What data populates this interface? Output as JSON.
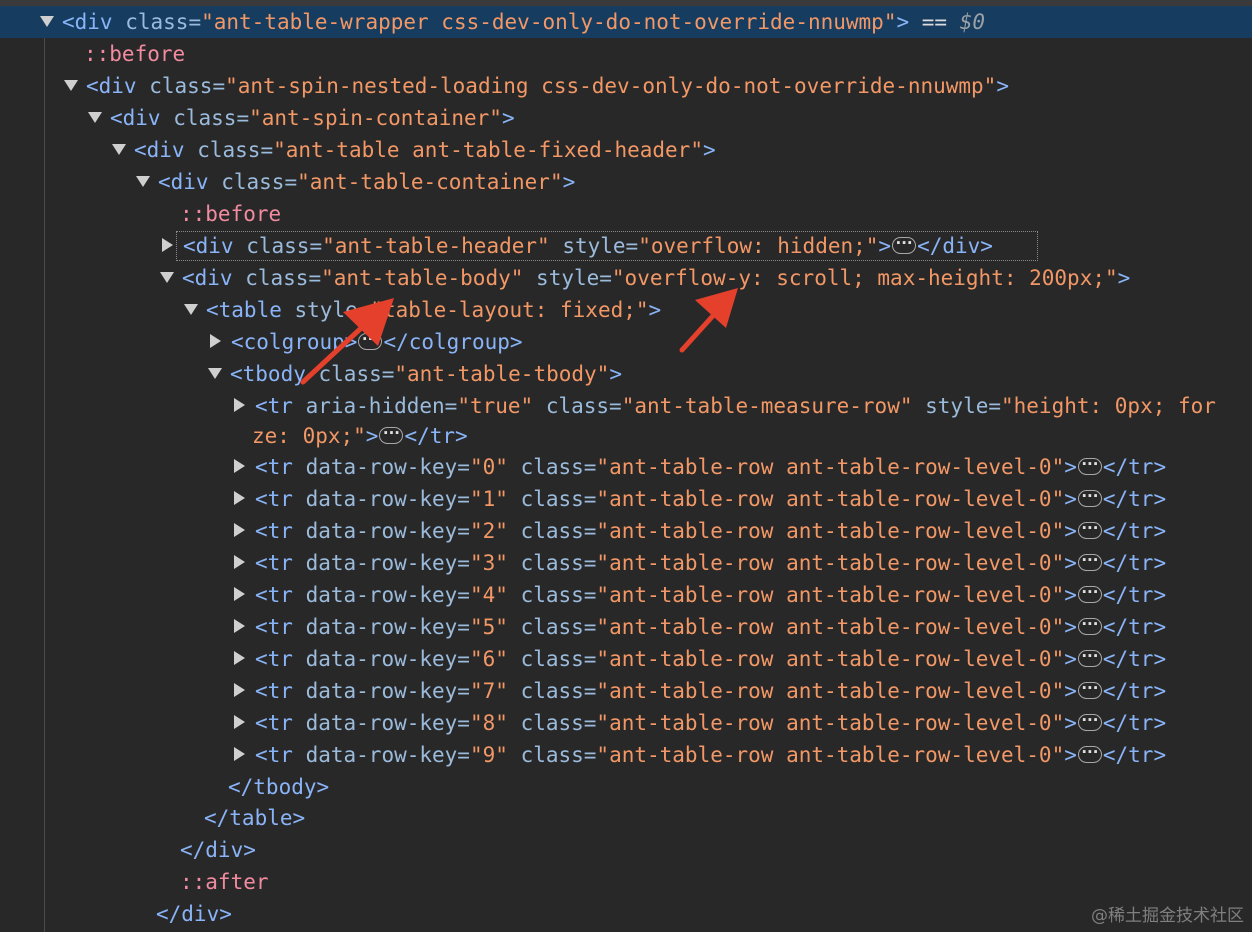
{
  "elements_tree": {
    "wrapper": {
      "tag_open": "<div",
      "attr_class": "class=",
      "class_value": "\"ant-table-wrapper css-dev-only-do-not-override-nnuwmp\"",
      "tag_close": ">",
      "eq": " == ",
      "dollar": "$0"
    },
    "before1": "::before",
    "spin_nested": {
      "tag_open": "<div",
      "attr_class": "class=",
      "class_value": "\"ant-spin-nested-loading css-dev-only-do-not-override-nnuwmp\"",
      "tag_close": ">"
    },
    "spin_container": {
      "tag_open": "<div",
      "attr_class": "class=",
      "class_value": "\"ant-spin-container\"",
      "tag_close": ">"
    },
    "table_div": {
      "tag_open": "<div",
      "attr_class": "class=",
      "class_value": "\"ant-table ant-table-fixed-header\"",
      "tag_close": ">"
    },
    "table_container": {
      "tag_open": "<div",
      "attr_class": "class=",
      "class_value": "\"ant-table-container\"",
      "tag_close": ">"
    },
    "before2": "::before",
    "table_header": {
      "tag_open": "<div",
      "attr_class": "class=",
      "class_value": "\"ant-table-header\"",
      "attr_style": "style=",
      "style_value": "\"overflow: hidden;\"",
      "tag_close": ">",
      "end_tag": "</div>"
    },
    "table_body": {
      "tag_open": "<div",
      "attr_class": "class=",
      "class_value": "\"ant-table-body\"",
      "attr_style": "style=",
      "style_value": "\"overflow-y: scroll; max-height: 200px;\"",
      "tag_close": ">"
    },
    "table": {
      "tag_open": "<table",
      "attr_style": "style=",
      "style_value": "\"table-layout: fixed;\"",
      "tag_close": ">"
    },
    "colgroup": {
      "tag_open": "<colgroup>",
      "end_tag": "</colgroup>"
    },
    "tbody": {
      "tag_open": "<tbody",
      "attr_class": "class=",
      "class_value": "\"ant-table-tbody\"",
      "tag_close": ">"
    },
    "measure_row": {
      "tag_open": "<tr",
      "attr_aria": "aria-hidden=",
      "aria_value": "\"true\"",
      "attr_class": "class=",
      "class_value": "\"ant-table-measure-row\"",
      "attr_style": "style=",
      "style_value_part1": "\"height: 0px; for",
      "style_value_part2": "ze: 0px;\"",
      "tag_close": ">",
      "end_tag": "</tr>"
    },
    "rows": [
      {
        "key": "\"0\""
      },
      {
        "key": "\"1\""
      },
      {
        "key": "\"2\""
      },
      {
        "key": "\"3\""
      },
      {
        "key": "\"4\""
      },
      {
        "key": "\"5\""
      },
      {
        "key": "\"6\""
      },
      {
        "key": "\"7\""
      },
      {
        "key": "\"8\""
      },
      {
        "key": "\"9\""
      }
    ],
    "row_tag_open": "<tr",
    "row_attr_key": "data-row-key=",
    "row_attr_class": "class=",
    "row_class_value": "\"ant-table-row ant-table-row-level-0\"",
    "row_tag_close": ">",
    "row_end_tag": "</tr>",
    "close_tbody": "</tbody>",
    "close_table": "</table>",
    "close_div1": "</div>",
    "after": "::after",
    "close_div2": "</div>"
  },
  "ellipsis_glyph": "···",
  "watermark": "@稀土掘金技术社区",
  "colors": {
    "background": "#282828",
    "selection": "#163d60",
    "tag": "#8ab4f8",
    "attribute": "#9bbbdc",
    "value": "#f29766",
    "pseudo": "#f28b9f",
    "arrow": "#e5402b"
  }
}
